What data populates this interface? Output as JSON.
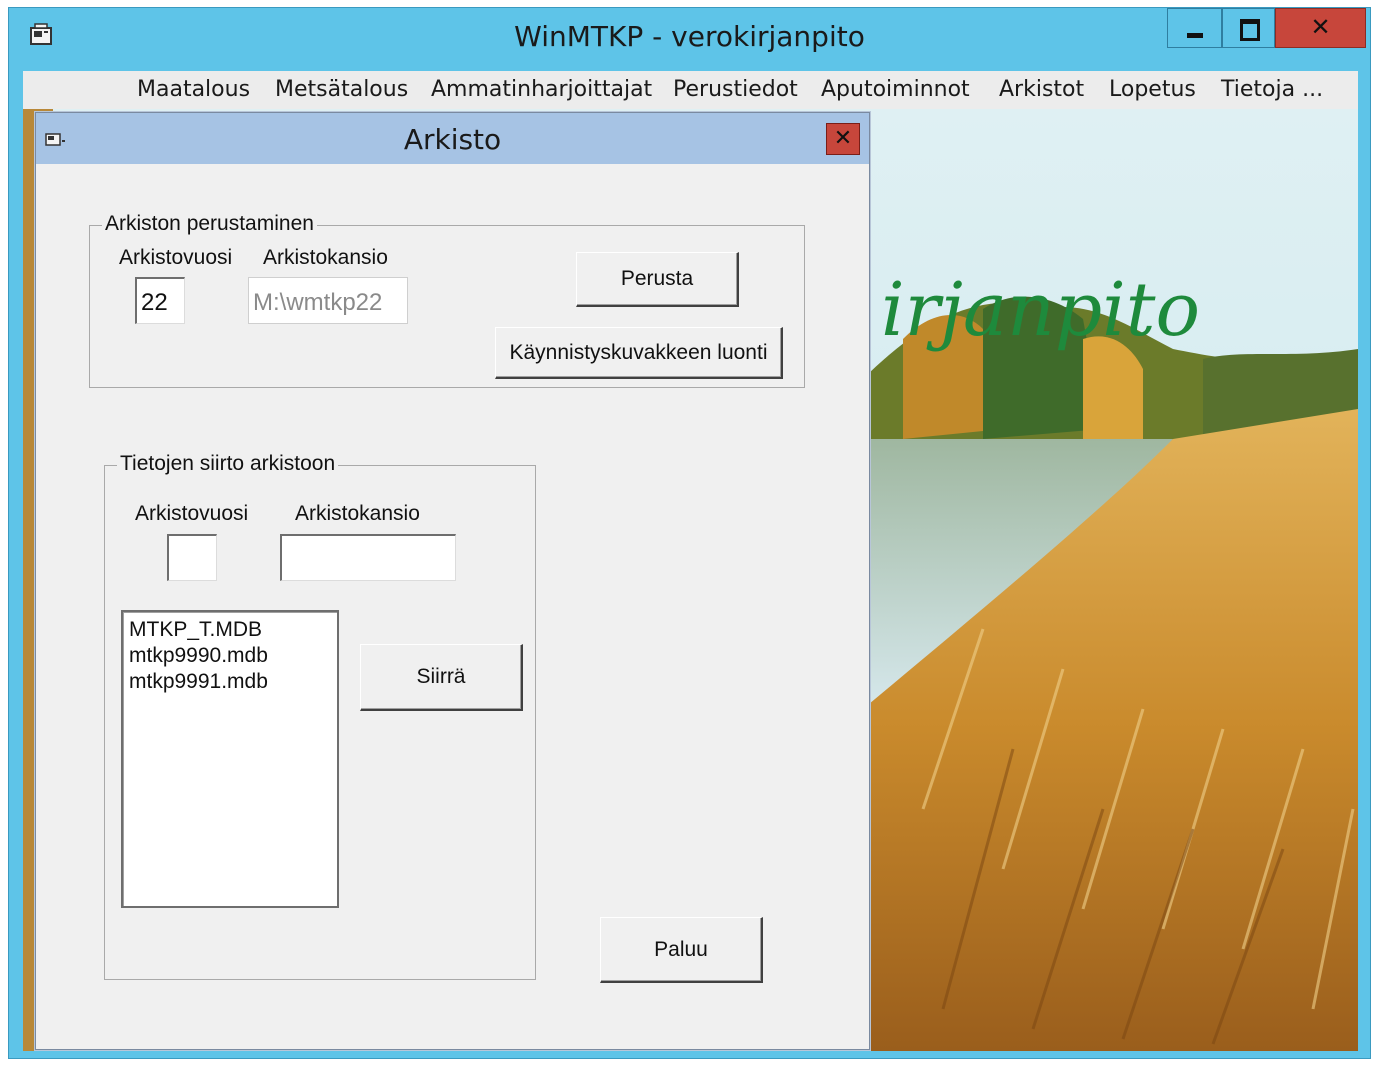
{
  "window": {
    "title": "WinMTKP - verokirjanpito",
    "controls": {
      "minimize": "minimize",
      "maximize": "maximize",
      "close": "✕"
    }
  },
  "menu": [
    "Maatalous",
    "Metsätalous",
    "Ammatinharjoittajat",
    "Perustiedot",
    "Aputoiminnot",
    "Arkistot",
    "Lopetus",
    "Tietoja ..."
  ],
  "background": {
    "title_fragment": "irjanpito"
  },
  "dialog": {
    "title": "Arkisto",
    "close_label": "✕",
    "create_group": {
      "label": "Arkiston perustaminen",
      "year_label": "Arkistovuosi",
      "folder_label": "Arkistokansio",
      "year_value": "22",
      "folder_value": "M:\\wmtkp22",
      "create_button": "Perusta",
      "shortcut_button": "Käynnistyskuvakkeen luonti"
    },
    "transfer_group": {
      "label": "Tietojen siirto arkistoon",
      "year_label": "Arkistovuosi",
      "folder_label": "Arkistokansio",
      "year_value": "",
      "folder_value": "",
      "files": [
        "MTKP_T.MDB",
        "mtkp9990.mdb",
        "mtkp9991.mdb"
      ],
      "move_button": "Siirrä"
    },
    "return_button": "Paluu"
  },
  "colors": {
    "titlebar": "#5ec4e8",
    "close_red": "#c7463b",
    "dialog_titlebar": "#a6c3e4",
    "bg_title_green": "#1e8a3c"
  }
}
